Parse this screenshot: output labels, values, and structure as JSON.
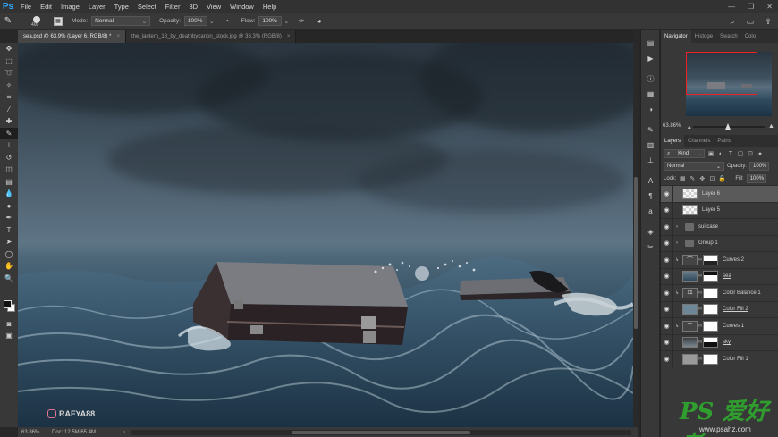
{
  "app": {
    "logo": "Ps"
  },
  "menu": [
    "File",
    "Edit",
    "Image",
    "Layer",
    "Type",
    "Select",
    "Filter",
    "3D",
    "View",
    "Window",
    "Help"
  ],
  "options_bar": {
    "brush_size": "400",
    "mode_label": "Mode:",
    "mode_value": "Normal",
    "opacity_label": "Opacity:",
    "opacity_value": "100%",
    "flow_label": "Flow:",
    "flow_value": "100%"
  },
  "tabs": [
    {
      "label": "sea.psd @ 63.9% (Layer 6, RGB/8) *",
      "active": true
    },
    {
      "label": "the_lantern_18_by_deathbycanon_stock.jpg @ 33.3% (RGB/8)",
      "active": false
    }
  ],
  "canvas": {
    "watermark_handle": "RAFYA88"
  },
  "status": {
    "zoom": "63.86%",
    "doc": "Doc: 12.5M/65.4M"
  },
  "navigator": {
    "tabs": [
      "Navigator",
      "Histoge",
      "Swatch",
      "Colo"
    ],
    "zoom": "63.86%"
  },
  "layers_panel": {
    "tabs": [
      "Layers",
      "Channels",
      "Paths"
    ],
    "kind_label": "Kind",
    "blend_mode": "Normal",
    "opacity_label": "Opacity:",
    "opacity_value": "100%",
    "lock_label": "Lock:",
    "fill_label": "Fill:",
    "fill_value": "100%",
    "layers": [
      {
        "name": "Layer 6",
        "type": "pixel",
        "selected": true
      },
      {
        "name": "Layer 5",
        "type": "pixel",
        "selected": false
      },
      {
        "name": "suitcase",
        "type": "group",
        "selected": false
      },
      {
        "name": "Group 1",
        "type": "group",
        "selected": false
      },
      {
        "name": "Curves 2",
        "type": "adjustment",
        "selected": false
      },
      {
        "name": "sea",
        "type": "masked",
        "selected": false
      },
      {
        "name": "Color Balance 1",
        "type": "adjustment",
        "selected": false
      },
      {
        "name": "Color Fill 2",
        "type": "fill",
        "selected": false
      },
      {
        "name": "Curves 1",
        "type": "adjustment",
        "selected": false
      },
      {
        "name": "sky",
        "type": "masked",
        "selected": false
      },
      {
        "name": "Color Fill 1",
        "type": "fill",
        "selected": false
      }
    ]
  },
  "site_watermark": {
    "chars": "PS 爱好者",
    "url": "www.psahz.com"
  },
  "colors": {
    "accent": "#31a8ff",
    "nav_rect": "#ee2222",
    "watermark_green": "#2f9e2f"
  }
}
